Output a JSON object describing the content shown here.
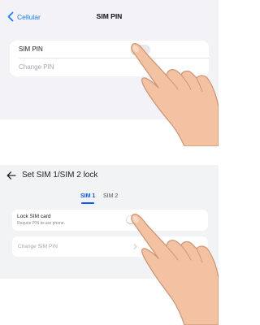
{
  "ios": {
    "back_label": "Cellular",
    "back_icon": "chevron-left-icon",
    "title": "SIM PIN",
    "rows": [
      {
        "label": "SIM PIN",
        "toggle": false
      },
      {
        "label": "Change PIN"
      }
    ],
    "accent": "#1e7cf5"
  },
  "android": {
    "back_icon": "arrow-left-icon",
    "title": "Set SIM 1/SIM 2 lock",
    "tabs": [
      {
        "label": "SIM 1",
        "active": true
      },
      {
        "label": "SIM 2",
        "active": false
      }
    ],
    "lock_card": {
      "label": "Lock SIM card",
      "subtitle": "Require PIN to use phone.",
      "toggle": false
    },
    "change_card": {
      "label": "Change SIM PIN",
      "arrow_icon": "chevron-right-icon"
    },
    "accent": "#0a59f7"
  },
  "hands": [
    {
      "icon": "pointing-hand-icon"
    },
    {
      "icon": "pointing-hand-icon"
    }
  ]
}
